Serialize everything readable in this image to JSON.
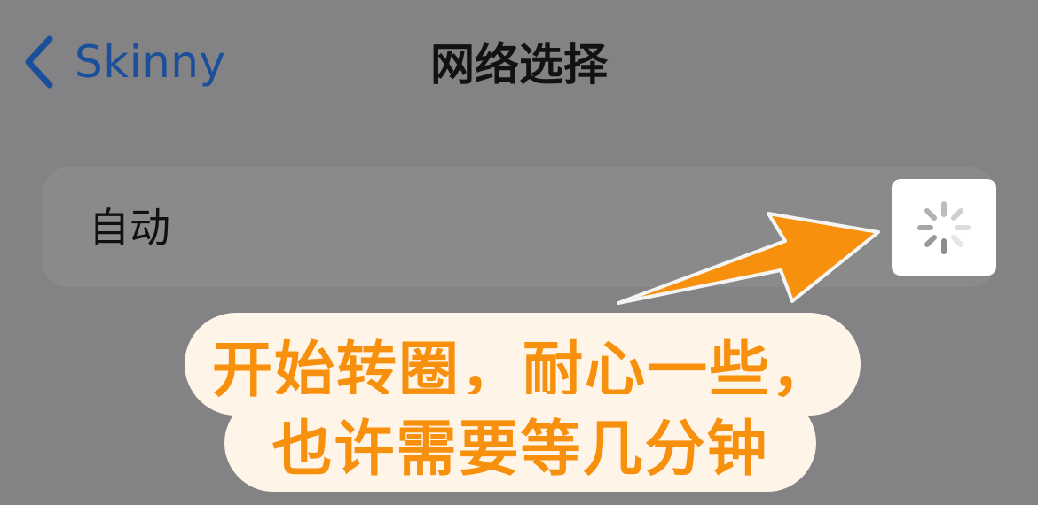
{
  "nav": {
    "back_label": "Skinny",
    "title": "网络选择",
    "back_icon": "chevron-left-icon"
  },
  "network": {
    "option_label": "自动",
    "status_icon": "loading-spinner-icon"
  },
  "annotation": {
    "line1": "开始转圈，耐心一些，",
    "line2": "也许需要等几分钟",
    "text_color": "#f7900c",
    "arrow_color": "#f7900c",
    "bubble_color": "#fff4e8"
  },
  "colors": {
    "background": "#838385",
    "accent_blue": "#1b4f9a"
  }
}
